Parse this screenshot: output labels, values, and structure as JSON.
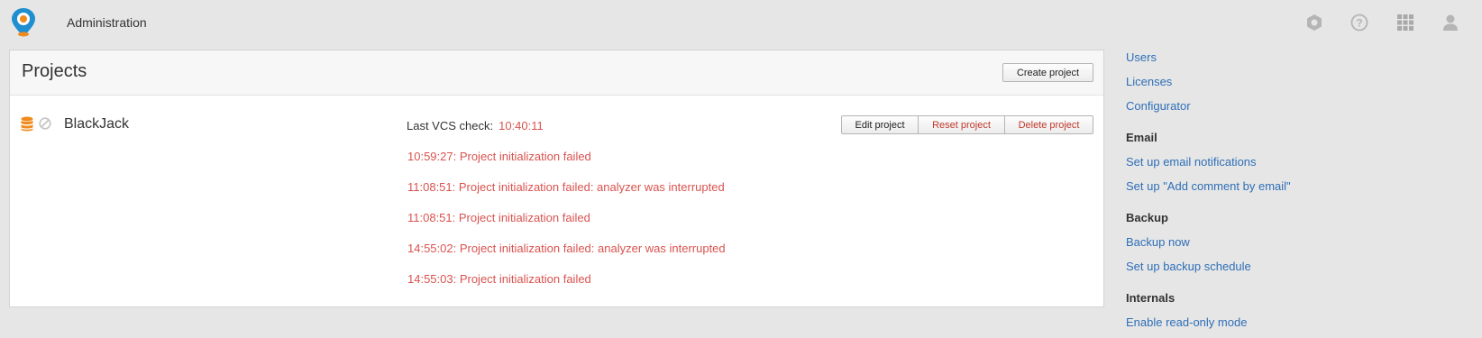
{
  "header": {
    "app_title": "Administration",
    "icons": [
      "settings-hexagon-icon",
      "help-icon",
      "apps-grid-icon",
      "user-icon"
    ]
  },
  "projects": {
    "title": "Projects",
    "create_label": "Create project",
    "items": [
      {
        "name": "BlackJack",
        "vcs_label": "Last VCS check:",
        "vcs_time": "10:40:11",
        "logs": [
          "10:59:27: Project initialization failed",
          "11:08:51: Project initialization failed: analyzer was interrupted",
          "11:08:51: Project initialization failed",
          "14:55:02: Project initialization failed: analyzer was interrupted",
          "14:55:03: Project initialization failed"
        ],
        "actions": {
          "edit": "Edit project",
          "reset": "Reset project",
          "delete": "Delete project"
        }
      }
    ]
  },
  "sidebar": {
    "users": "Users",
    "licenses": "Licenses",
    "configurator": "Configurator",
    "email_heading": "Email",
    "email_notifications": "Set up email notifications",
    "email_comment": "Set up \"Add comment by email\"",
    "backup_heading": "Backup",
    "backup_now": "Backup now",
    "backup_schedule": "Set up backup schedule",
    "internals_heading": "Internals",
    "read_only": "Enable read-only mode"
  },
  "colors": {
    "accent_link": "#2f6fb7",
    "error": "#d9534f",
    "logo_blue": "#1f8fd0",
    "logo_orange": "#f08a1c"
  }
}
